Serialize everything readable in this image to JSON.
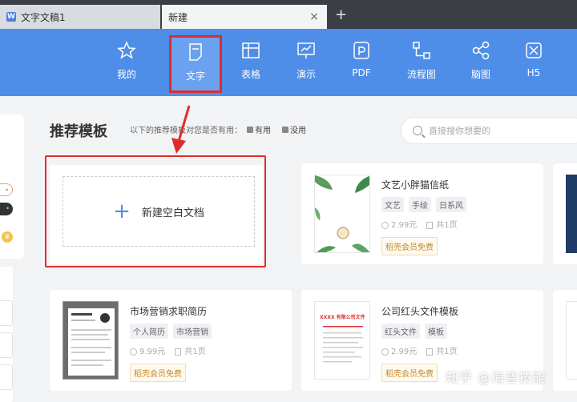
{
  "tabs": [
    {
      "label": "文字文稿1",
      "icon": "W"
    },
    {
      "label": "新建"
    }
  ],
  "toolbar": {
    "items": [
      {
        "label": "我的",
        "icon": "star-icon"
      },
      {
        "label": "文字",
        "icon": "document-icon",
        "active": true
      },
      {
        "label": "表格",
        "icon": "table-icon"
      },
      {
        "label": "演示",
        "icon": "presentation-icon"
      },
      {
        "label": "PDF",
        "icon": "pdf-icon"
      },
      {
        "label": "流程图",
        "icon": "flowchart-icon"
      },
      {
        "label": "脑图",
        "icon": "mindmap-icon"
      },
      {
        "label": "H5",
        "icon": "h5-icon"
      }
    ],
    "accent": "#4e8ee8",
    "highlight": "#e02b2b"
  },
  "main": {
    "heading": "推荐模板",
    "feedback_prompt": "以下的推荐模板对您是否有用：",
    "useful": "有用",
    "not_useful": "没用",
    "search_placeholder": "直接搜你想要的",
    "new_blank": "新建空白文档"
  },
  "templates": [
    {
      "title": "文艺小胖猫信纸",
      "tags": [
        "文艺",
        "手绘",
        "日系风"
      ],
      "price": "2.99元",
      "pages": "共1页",
      "vip": "稻壳会员免费"
    },
    {
      "title": "市场营销求职简历",
      "tags": [
        "个人简历",
        "市场营销"
      ],
      "price": "9.99元",
      "pages": "共1页",
      "vip": "稻壳会员免费"
    },
    {
      "title": "公司红头文件模板",
      "tags": [
        "红头文件",
        "模板"
      ],
      "price": "2.99元",
      "pages": "共1页",
      "vip": "稻壳会员免费"
    }
  ],
  "redhead_text": "XXXX 有限公司文件",
  "watermark": "知乎 @海普技能"
}
